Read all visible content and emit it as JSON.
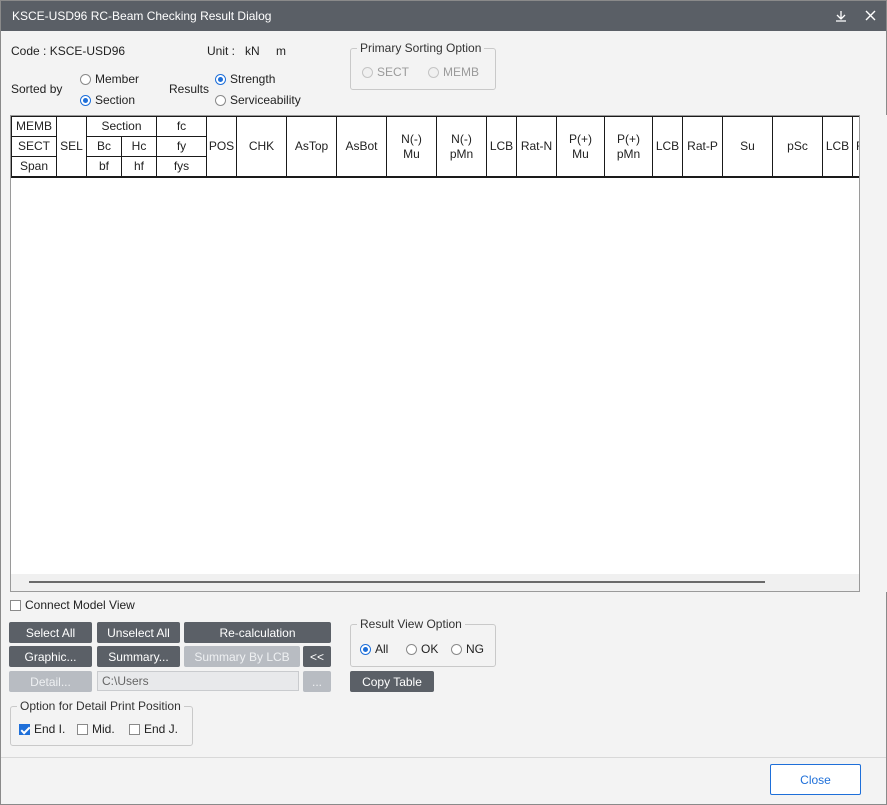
{
  "window": {
    "title": "KSCE-USD96 RC-Beam Checking Result Dialog",
    "help_icon": "download-arrow-icon",
    "close_icon": "close-x-icon"
  },
  "info": {
    "code": "Code : KSCE-USD96",
    "unit_label": "Unit :",
    "unit_force": "kN",
    "unit_length": "m"
  },
  "sorted_by": {
    "label": "Sorted by",
    "options": [
      "Member",
      "Section"
    ],
    "selected": "Section"
  },
  "results": {
    "label": "Results",
    "options": [
      "Strength",
      "Serviceability"
    ],
    "selected": "Strength"
  },
  "primary_sorting": {
    "title": "Primary Sorting Option",
    "options": [
      "SECT",
      "MEMB"
    ],
    "disabled": true
  },
  "table": {
    "headers": {
      "memb": "MEMB",
      "sect": "SECT",
      "span": "Span",
      "sel": "SEL",
      "section": "Section",
      "bc": "Bc",
      "hc": "Hc",
      "bf": "bf",
      "hf": "hf",
      "fc": "fc",
      "fy": "fy",
      "fys": "fys",
      "pos": "POS",
      "chk": "CHK",
      "astop": "AsTop",
      "asbot": "AsBot",
      "n_mu": "N(-)\nMu",
      "n_pmn": "N(-)\npMn",
      "lcb1": "LCB",
      "rat_n": "Rat-N",
      "p_mu": "P(+)\nMu",
      "p_pmn": "P(+)\npMn",
      "lcb2": "LCB",
      "rat_p": "Rat-P",
      "su": "Su",
      "psc": "pSc",
      "lcb3": "LCB",
      "trunc": "R"
    },
    "rows": []
  },
  "connect_model_view": {
    "label": "Connect Model View",
    "checked": false
  },
  "buttons": {
    "select_all": "Select All",
    "unselect_all": "Unselect All",
    "recalculation": "Re-calculation",
    "graphic": "Graphic...",
    "summary": "Summary...",
    "summary_by_lcb": "Summary By LCB",
    "collapse": "<<",
    "detail": "Detail...",
    "browse": "...",
    "copy_table": "Copy Table",
    "close": "Close"
  },
  "path": {
    "value": "C:\\Users"
  },
  "detail_print": {
    "title": "Option for Detail Print Position",
    "options": [
      "End I.",
      "Mid.",
      "End J."
    ],
    "checked": [
      "End I."
    ]
  },
  "result_view": {
    "title": "Result View Option",
    "options": [
      "All",
      "OK",
      "NG"
    ],
    "selected": "All"
  },
  "colors": {
    "titlebar": "#5a5f66",
    "button": "#5b6067",
    "accent": "#1e6fd9"
  }
}
